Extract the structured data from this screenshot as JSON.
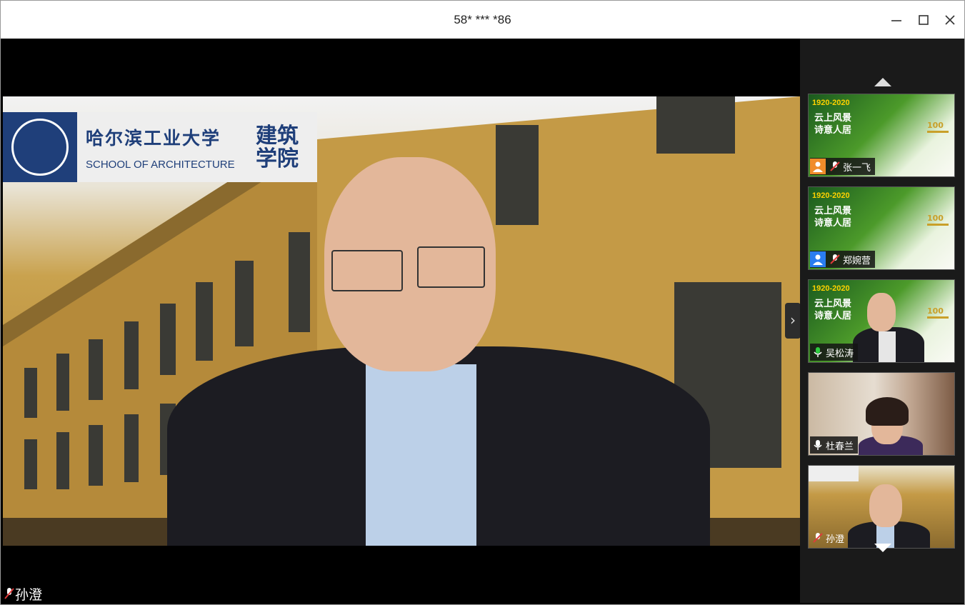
{
  "window": {
    "title": "58* *** *86",
    "controls": {
      "minimize": "minimize",
      "maximize": "maximize",
      "close": "close"
    }
  },
  "main_video": {
    "banner": {
      "school_cn": "哈尔滨工业大学",
      "school_en": "SCHOOL OF ARCHITECTURE",
      "school_big": "建筑学院"
    },
    "speaker_name": "孙澄",
    "speaker_mic": "muted"
  },
  "sidebar": {
    "poster": {
      "years": "1920-2020",
      "line1": "云上风景",
      "line2": "诗意人居",
      "badge": "100"
    },
    "participants": [
      {
        "name": "张一飞",
        "avatar": "orange-person-icon",
        "mic": "muted",
        "video": "poster"
      },
      {
        "name": "郑婉营",
        "avatar": "blue-person-icon",
        "mic": "muted",
        "video": "poster"
      },
      {
        "name": "吴松涛",
        "mic": "active",
        "video": "poster-with-person"
      },
      {
        "name": "杜春兰",
        "mic": "on",
        "video": "person"
      },
      {
        "name": "孙澄",
        "mic": "muted",
        "video": "background-person"
      }
    ]
  },
  "colors": {
    "titlebar_bg": "#ffffff",
    "sidebar_bg": "#1a1a1a",
    "mic_active": "#2ecc40",
    "mic_muted": "#e03a3a",
    "accent_blue": "#1f3f7a"
  }
}
